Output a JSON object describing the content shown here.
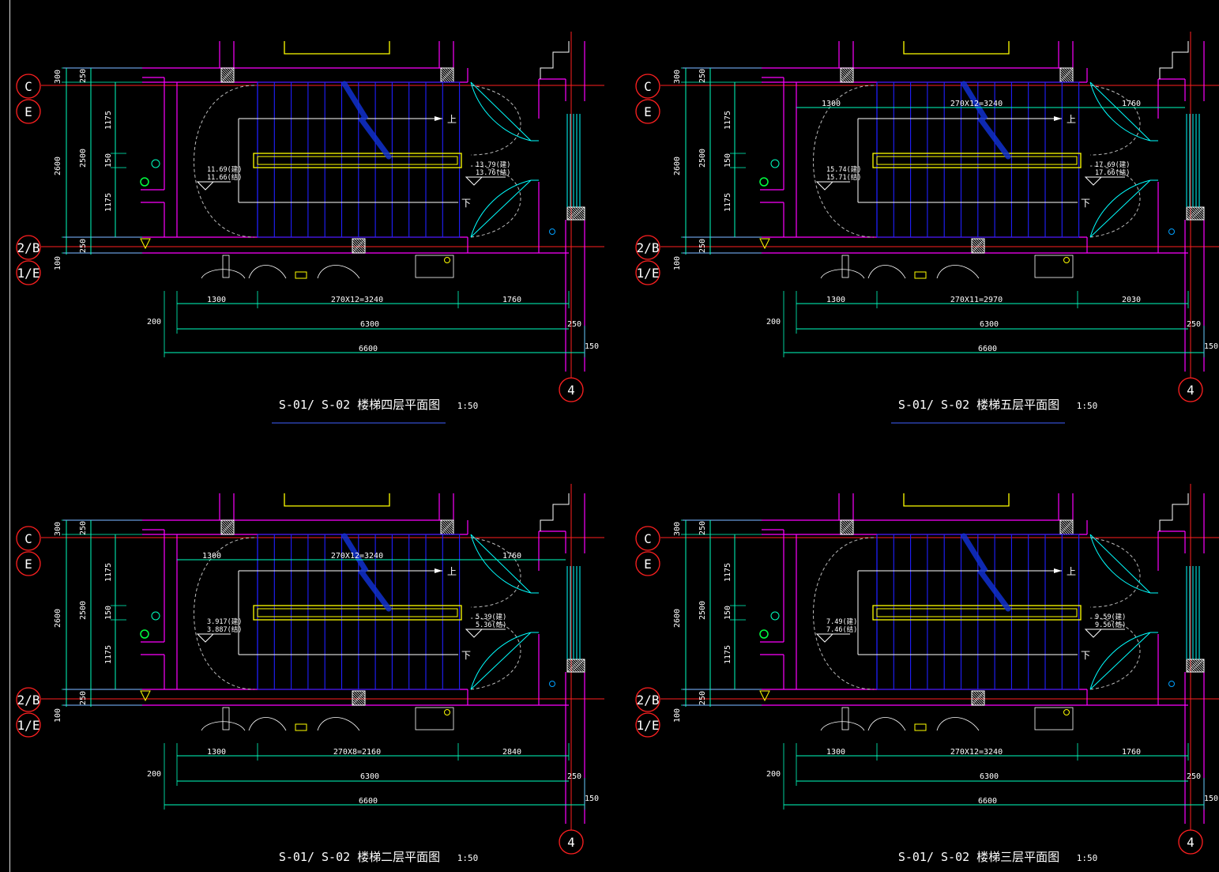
{
  "plans": [
    {
      "title": "S-01/ S-02 楼梯四层平面图",
      "scale": "1:50",
      "left_dims": [
        "300",
        "250",
        "2600",
        "2500",
        "1175",
        "150",
        "1175",
        "250",
        "100"
      ],
      "axis_left_top": [
        "C",
        "E"
      ],
      "axis_left_bottom": [
        "2/B",
        "1/E"
      ],
      "axis_bottom_right": "4",
      "inner_dims": [],
      "dims_row1": [
        "1300",
        "270X12=3240",
        "1760"
      ],
      "dim_6300": "6300",
      "dim_6600": "6600",
      "dim_200": "200",
      "dim_250": "250",
      "dim_150": "150",
      "elev_left": [
        "11.69(建)",
        "11.66(结)"
      ],
      "elev_right": [
        "13.79(建)",
        "13.76(结)"
      ],
      "up_label": "上",
      "down_label": "下"
    },
    {
      "title": "S-01/ S-02 楼梯五层平面图",
      "scale": "1:50",
      "left_dims": [
        "300",
        "250",
        "2600",
        "2500",
        "1175",
        "150",
        "1175",
        "250",
        "100"
      ],
      "axis_left_top": [
        "C",
        "E"
      ],
      "axis_left_bottom": [
        "2/B",
        "1/E"
      ],
      "axis_bottom_right": "4",
      "inner_dims": [
        "1300",
        "270X12=3240",
        "1760"
      ],
      "dims_row1": [
        "1300",
        "270X11=2970",
        "2030"
      ],
      "dim_6300": "6300",
      "dim_6600": "6600",
      "dim_200": "200",
      "dim_250": "250",
      "dim_150": "150",
      "elev_left": [
        "15.74(建)",
        "15.71(结)"
      ],
      "elev_right": [
        "17.69(建)",
        "17.66(结)"
      ],
      "up_label": "上",
      "down_label": "下"
    },
    {
      "title": "S-01/ S-02 楼梯二层平面图",
      "scale": "1:50",
      "left_dims": [
        "300",
        "250",
        "2600",
        "2500",
        "1175",
        "150",
        "1175",
        "250",
        "100"
      ],
      "axis_left_top": [
        "C",
        "E"
      ],
      "axis_left_bottom": [
        "2/B",
        "1/E"
      ],
      "axis_bottom_right": "4",
      "inner_dims": [
        "1300",
        "270X12=3240",
        "1760"
      ],
      "dims_row1": [
        "1300",
        "270X8=2160",
        "2840"
      ],
      "dim_6300": "6300",
      "dim_6600": "6600",
      "dim_200": "200",
      "dim_250": "250",
      "dim_150": "150",
      "elev_left": [
        "3.917(建)",
        "3.887(结)"
      ],
      "elev_right": [
        "5.39(建)",
        "5.36(结)"
      ],
      "up_label": "上",
      "down_label": "下"
    },
    {
      "title": "S-01/ S-02 楼梯三层平面图",
      "scale": "1:50",
      "left_dims": [
        "300",
        "250",
        "2600",
        "2500",
        "1175",
        "150",
        "1175",
        "250",
        "100"
      ],
      "axis_left_top": [
        "C",
        "E"
      ],
      "axis_left_bottom": [
        "2/B",
        "1/E"
      ],
      "axis_bottom_right": "4",
      "inner_dims": [],
      "dims_row1": [
        "1300",
        "270X12=3240",
        "1760"
      ],
      "dim_6300": "6300",
      "dim_6600": "6600",
      "dim_200": "200",
      "dim_250": "250",
      "dim_150": "150",
      "elev_left": [
        "7.49(建)",
        "7.46(结)"
      ],
      "elev_right": [
        "9.59(建)",
        "9.56(结)"
      ],
      "up_label": "上",
      "down_label": "下"
    }
  ],
  "colors": {
    "background": "#000000",
    "wall": "#ff00ff",
    "axis": "#ff2020",
    "dimension": "#00ffc0",
    "stair": "#2020ff",
    "rail": "#ffff00",
    "door": "#00ffff",
    "text": "#ffffff",
    "title_underline": "#4060ff"
  }
}
